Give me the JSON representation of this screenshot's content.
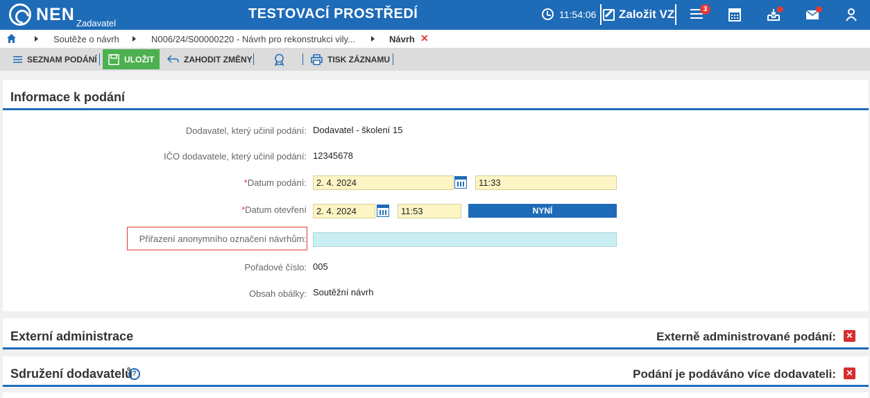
{
  "topbar": {
    "logo": "NEN",
    "logo_sub": "Zadavatel",
    "env_title": "TESTOVACÍ PROSTŘEDÍ",
    "time": "11:54:06",
    "create_label": "Založit VZ",
    "menu_badge": "3"
  },
  "breadcrumb": {
    "items": [
      "Soutěže o návrh",
      "N006/24/S00000220 - Návrh pro rekonstrukci vily..."
    ],
    "current": "Návrh",
    "close_glyph": "✕"
  },
  "toolbar": {
    "list_label": "SEZNAM PODÁNÍ",
    "save_label": "ULOŽIT",
    "discard_label": "ZAHODIT ZMĚNY",
    "print_label": "TISK ZÁZNAMU"
  },
  "info": {
    "title": "Informace k podání",
    "supplier_label": "Dodavatel, který učinil podání:",
    "supplier_value": "Dodavatel - školení 15",
    "ico_label": "IČO dodavatele, který učinil podání:",
    "ico_value": "12345678",
    "date_submit_label": "Datum podání:",
    "date_submit_value": "2. 4. 2024",
    "time_submit_value": "11:33",
    "date_open_label": "Datum otevření",
    "date_open_value": "2. 4. 2024",
    "time_open_value": "11:53",
    "now_button": "NYNÍ",
    "anon_label": "Přiřazení anonymního označení návrhům:",
    "anon_value": "",
    "order_label": "Pořadové číslo:",
    "order_value": "005",
    "envelope_label": "Obsah obálky:",
    "envelope_value": "Soutěžní návrh"
  },
  "external": {
    "title": "Externí administrace",
    "right_label": "Externě administrované podání:"
  },
  "association": {
    "title": "Sdružení dodavatelů",
    "right_label": "Podání je podáváno více dodavateli:"
  },
  "colors": {
    "primary": "#1e6bb8",
    "save": "#4caf50",
    "danger": "#d32f2f",
    "input": "#fdf5c4"
  }
}
